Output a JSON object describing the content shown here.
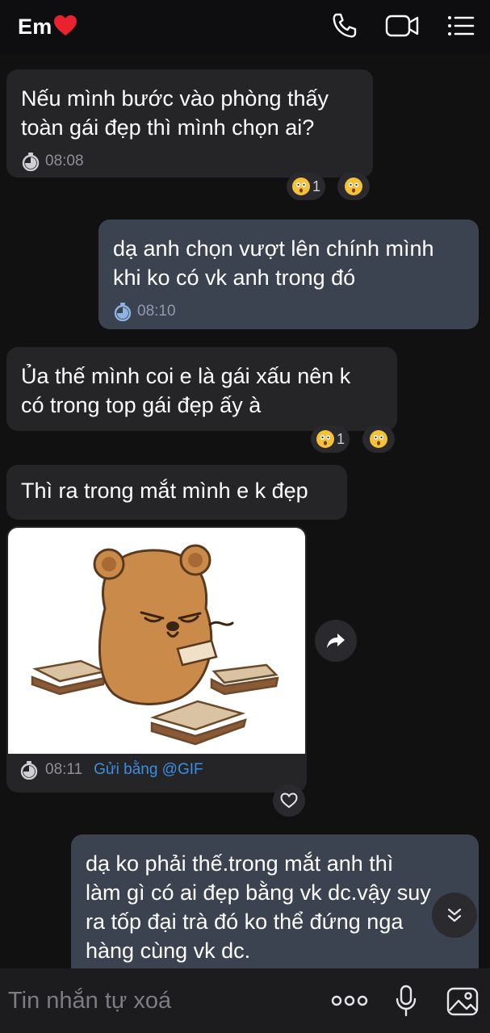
{
  "header": {
    "title": "Em",
    "icons": [
      "phone-icon",
      "video-call-icon",
      "menu-icon"
    ]
  },
  "messages": [
    {
      "side": "in",
      "text_lines": [
        "Nếu mình bước vào phòng thấy",
        "toàn gái đẹp thì mình chọn ai?"
      ],
      "time": "08:08",
      "reaction_count": "1"
    },
    {
      "side": "out",
      "text_lines": [
        "dạ anh chọn vượt lên chính mình",
        "khi ko có vk anh trong đó"
      ],
      "time": "08:10"
    },
    {
      "side": "in",
      "text_lines": [
        "Ủa thế mình coi e là gái xấu nên k",
        "có trong top gái đẹp ấy à"
      ],
      "reaction_count": "1"
    },
    {
      "side": "in",
      "text_lines": [
        "Thì ra trong mắt mình e k đẹp"
      ]
    },
    {
      "side": "in",
      "type": "gif",
      "time": "08:11",
      "source": "Gửi bằng @GIF"
    },
    {
      "side": "out",
      "text_lines": [
        "dạ ko phải thế.trong mắt anh thì",
        "làm gì có ai đẹp bằng vk dc.vậy suy",
        "ra tốp đại trà đó ko thể đứng nga",
        "hàng cùng vk dc."
      ]
    }
  ],
  "input": {
    "placeholder": "Tin nhắn tự xoá"
  },
  "colors": {
    "incoming_bubble": "#252528",
    "outgoing_bubble": "#3b4350",
    "link": "#3a8fe3",
    "heart": "#e8232f"
  }
}
